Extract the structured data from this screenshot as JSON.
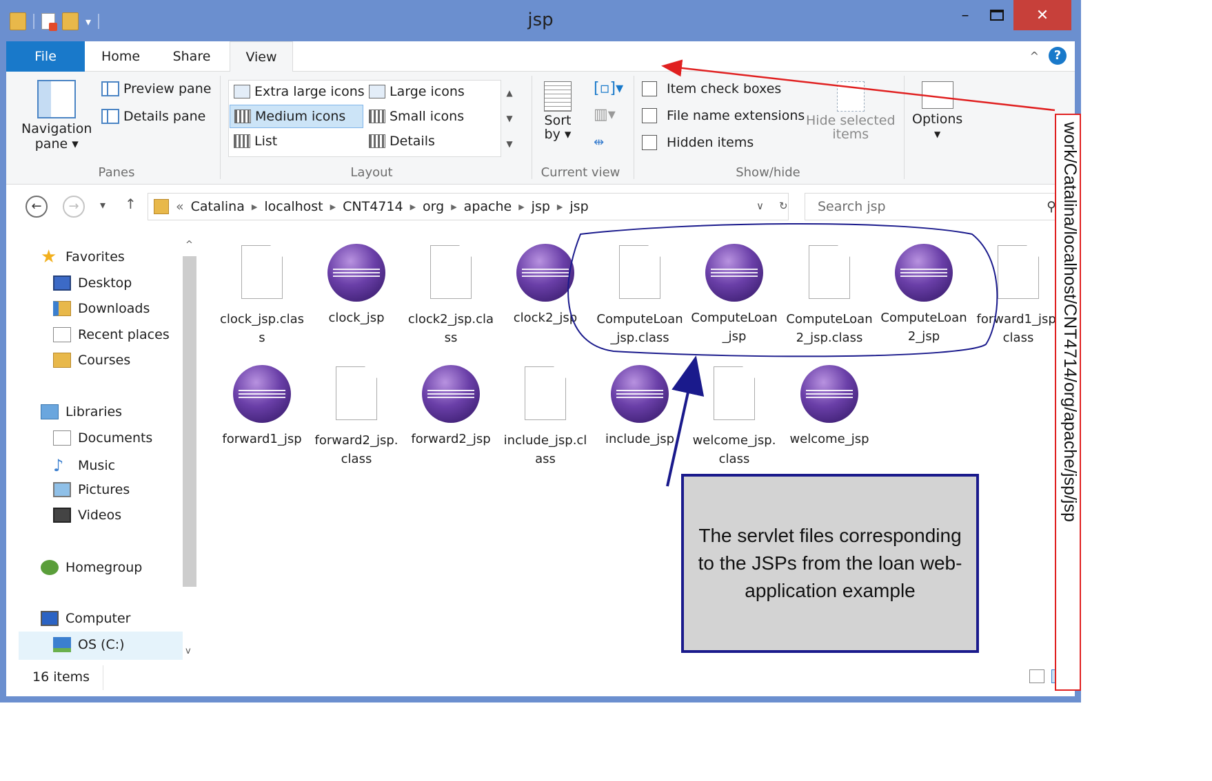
{
  "window": {
    "title": "jsp"
  },
  "ribbon": {
    "tabs": [
      "File",
      "Home",
      "Share",
      "View"
    ],
    "panes": {
      "navigation_pane": "Navigation",
      "navigation_pane_2": "pane",
      "preview_pane": "Preview pane",
      "details_pane": "Details pane",
      "group": "Panes"
    },
    "layout": {
      "items": [
        "Extra large icons",
        "Large icons",
        "Medium icons",
        "Small icons",
        "List",
        "Details"
      ],
      "selected": "Medium icons",
      "group": "Layout"
    },
    "current_view": {
      "sort_by_1": "Sort",
      "sort_by_2": "by",
      "group": "Current view"
    },
    "show_hide": {
      "item_check_boxes": "Item check boxes",
      "file_name_extensions": "File name extensions",
      "hidden_items": "Hidden items",
      "hide_selected_1": "Hide selected",
      "hide_selected_2": "items",
      "group": "Show/hide"
    },
    "options": "Options"
  },
  "address": {
    "prefix": "«",
    "crumbs": [
      "Catalina",
      "localhost",
      "CNT4714",
      "org",
      "apache",
      "jsp",
      "jsp"
    ],
    "search_placeholder": "Search jsp"
  },
  "nav_pane": {
    "favorites": "Favorites",
    "desktop": "Desktop",
    "downloads": "Downloads",
    "recent_places": "Recent places",
    "courses": "Courses",
    "libraries": "Libraries",
    "documents": "Documents",
    "music": "Music",
    "pictures": "Pictures",
    "videos": "Videos",
    "homegroup": "Homegroup",
    "computer": "Computer",
    "os_drive": "OS (C:)"
  },
  "files": [
    {
      "name": "clock_jsp.class",
      "icon": "document-icon"
    },
    {
      "name": "clock_jsp",
      "icon": "eclipse-icon"
    },
    {
      "name": "clock2_jsp.class",
      "icon": "document-icon"
    },
    {
      "name": "clock2_jsp",
      "icon": "eclipse-icon"
    },
    {
      "name": "ComputeLoan_jsp.class",
      "icon": "document-icon"
    },
    {
      "name": "ComputeLoan_jsp",
      "icon": "eclipse-icon"
    },
    {
      "name": "ComputeLoan2_jsp.class",
      "icon": "document-icon"
    },
    {
      "name": "ComputeLoan2_jsp",
      "icon": "eclipse-icon"
    },
    {
      "name": "forward1_jsp.class",
      "icon": "document-icon"
    },
    {
      "name": "forward1_jsp",
      "icon": "eclipse-icon"
    },
    {
      "name": "forward2_jsp.class",
      "icon": "document-icon"
    },
    {
      "name": "forward2_jsp",
      "icon": "eclipse-icon"
    },
    {
      "name": "include_jsp.class",
      "icon": "document-icon"
    },
    {
      "name": "include_jsp",
      "icon": "eclipse-icon"
    },
    {
      "name": "welcome_jsp.class",
      "icon": "document-icon"
    },
    {
      "name": "welcome_jsp",
      "icon": "eclipse-icon"
    }
  ],
  "status": {
    "item_count": "16 items"
  },
  "annotations": {
    "path_label": "work/Catalina/localhost/CNT4714/org/apache/jsp/jsp",
    "callout": "The servlet files corresponding to the JSPs from the loan web-application example"
  },
  "colors": {
    "titlebar": "#6b8fcf",
    "file_tab": "#1979ca",
    "close_button": "#c7403a",
    "callout_border": "#1a1a8c",
    "arrow_red": "#e02020"
  }
}
